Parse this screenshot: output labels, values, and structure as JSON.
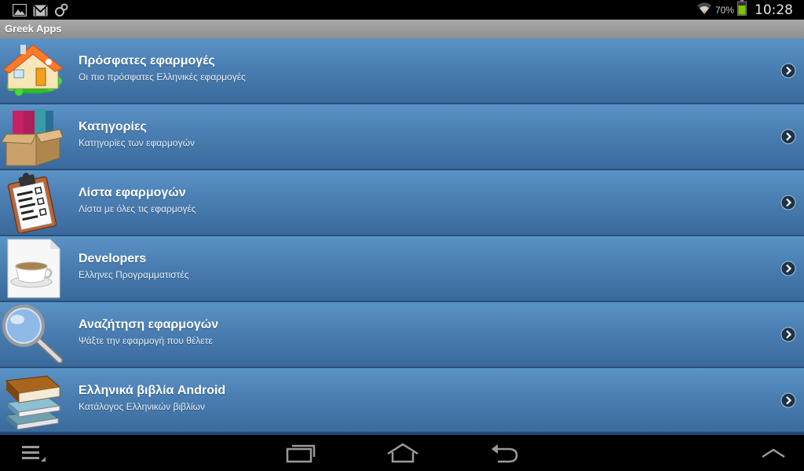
{
  "status_bar": {
    "battery_percent": "70%",
    "time": "10:28",
    "icons": [
      "gallery-notification-icon",
      "gmail-notification-icon",
      "sync-notification-icon",
      "wifi-icon",
      "battery-icon"
    ]
  },
  "app": {
    "title": "Greek Apps"
  },
  "menu": {
    "items": [
      {
        "title": "Πρόσφατες εφαρμογές",
        "subtitle": "Οι πιο πρόσφατες Ελληνικές εφαρμογές",
        "icon": "house-icon"
      },
      {
        "title": "Κατηγορίες",
        "subtitle": "Κατηγορίες των εφαρμογών",
        "icon": "box-of-books-icon"
      },
      {
        "title": "Λίστα εφαρμογών",
        "subtitle": "Λίστα με όλες τις εφαρμογές",
        "icon": "clipboard-icon"
      },
      {
        "title": "Developers",
        "subtitle": "Ελληνες Προγραμματιστές",
        "icon": "coffee-cup-icon"
      },
      {
        "title": "Αναζήτηση εφαρμογών",
        "subtitle": "Ψάξτε την εφαρμογή που θέλετε",
        "icon": "magnifier-icon"
      },
      {
        "title": "Ελληνικά βιβλία Android",
        "subtitle": "Κατάλογος Ελληνικών βιβλίων",
        "icon": "books-stack-icon"
      }
    ]
  },
  "nav_bar": {
    "buttons": [
      "menu-icon",
      "recent-apps-icon",
      "home-icon",
      "back-icon",
      "expand-up-icon"
    ]
  },
  "colors": {
    "list_item_top": "#5a93c7",
    "list_item_bottom": "#3a6a9c",
    "title_bar": "#9a9a9a",
    "battery_green": "#7cc400"
  }
}
